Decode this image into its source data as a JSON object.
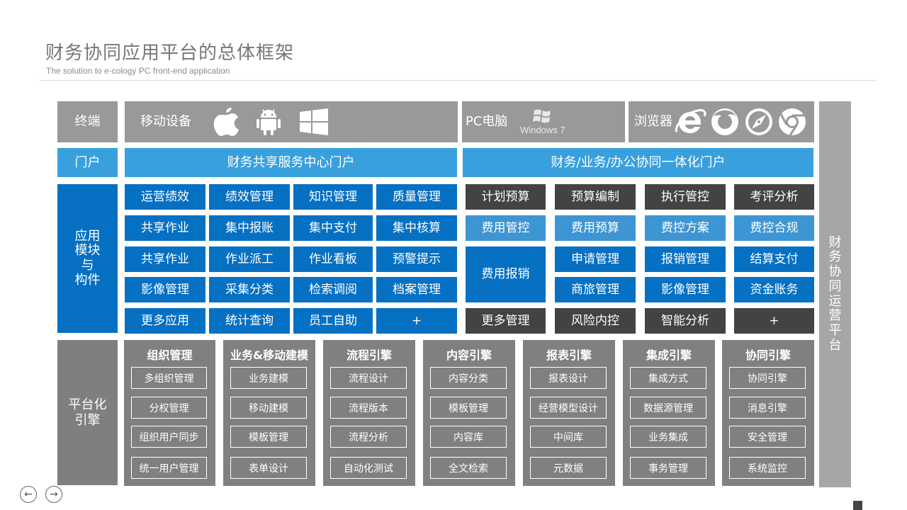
{
  "header": {
    "title": "财务协同应用平台的总体框架",
    "subtitle": "The solution to e-cology PC front-end application"
  },
  "rows": {
    "terminal": "终端",
    "portal": "门户",
    "app": "应用\n模块\n与\n构件",
    "platform": "平台化\n引擎"
  },
  "terminal": {
    "mobile": "移动设备",
    "pc": "PC电脑",
    "windows": "Windows 7",
    "browser": "浏览器",
    "icons": [
      "apple-icon",
      "android-icon",
      "windows-icon",
      "windows7-logo-icon",
      "ie-icon",
      "firefox-icon",
      "safari-icon",
      "chrome-icon"
    ]
  },
  "portal": {
    "left": "财务共享服务中心门户",
    "right": "财务/业务/办公协同一体化门户"
  },
  "app_left": [
    [
      "运营绩效",
      "绩效管理",
      "知识管理",
      "质量管理"
    ],
    [
      "共享作业",
      "集中报账",
      "集中支付",
      "集中核算"
    ],
    [
      "共享作业",
      "作业派工",
      "作业看板",
      "预警提示"
    ],
    [
      "影像管理",
      "采集分类",
      "检索调阅",
      "档案管理"
    ],
    [
      "更多应用",
      "统计查询",
      "员工自助",
      "+"
    ]
  ],
  "app_right": {
    "row1": [
      "计划预算",
      "预算编制",
      "执行管控",
      "考评分析"
    ],
    "row2": [
      "费用管控",
      "费用预算",
      "费控方案",
      "费控合规"
    ],
    "merged": "费用报销",
    "row3": [
      "申请管理",
      "报销管理",
      "结算支付"
    ],
    "row4": [
      "商旅管理",
      "影像管理",
      "资金账务"
    ],
    "row5": [
      "更多管理",
      "风险内控",
      "智能分析",
      "+"
    ]
  },
  "engines": [
    {
      "title": "组织管理",
      "items": [
        "多组织管理",
        "分权管理",
        "组织用户同步",
        "统一用户管理"
      ]
    },
    {
      "title": "业务&移动建模",
      "items": [
        "业务建模",
        "移动建模",
        "模板管理",
        "表单设计"
      ]
    },
    {
      "title": "流程引擎",
      "items": [
        "流程设计",
        "流程版本",
        "流程分析",
        "自动化测试"
      ]
    },
    {
      "title": "内容引擎",
      "items": [
        "内容分类",
        "模板管理",
        "内容库",
        "全文检索"
      ]
    },
    {
      "title": "报表引擎",
      "items": [
        "报表设计",
        "经营模型设计",
        "中间库",
        "元数据"
      ]
    },
    {
      "title": "集成引擎",
      "items": [
        "集成方式",
        "数据源管理",
        "业务集成",
        "事务管理"
      ]
    },
    {
      "title": "协同引擎",
      "items": [
        "协同引擎",
        "消息引擎",
        "安全管理",
        "系统监控"
      ]
    }
  ],
  "side": {
    "right_label": "财\n务\n协\n同\n运\n营\n平\n台"
  },
  "nav": {
    "prev": "←",
    "next": "→"
  },
  "colors": {
    "gray": "#999999",
    "light_blue": "#39a0de",
    "blue": "#0670c3",
    "dark": "#434343",
    "engine_gray": "#808080",
    "side_gray": "#a6a6a6"
  }
}
